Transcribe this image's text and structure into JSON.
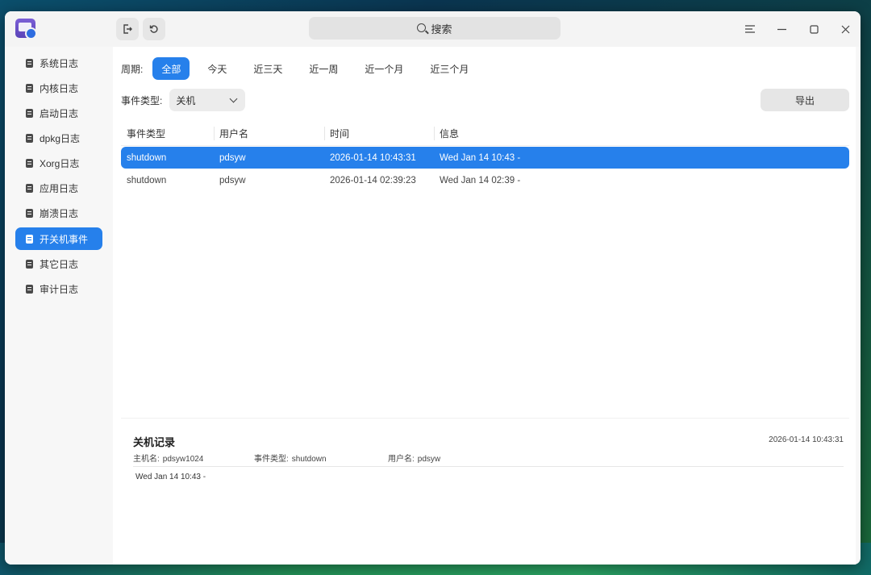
{
  "window": {
    "search_placeholder": "搜索",
    "icons": {
      "toolbar_1": "export-icon",
      "toolbar_2": "refresh-icon",
      "menu": "menu-icon",
      "minimize": "minimize-icon",
      "maximize": "maximize-icon",
      "close": "close-icon"
    }
  },
  "sidebar": {
    "items": [
      {
        "label": "系统日志"
      },
      {
        "label": "内核日志"
      },
      {
        "label": "启动日志"
      },
      {
        "label": "dpkg日志"
      },
      {
        "label": "Xorg日志"
      },
      {
        "label": "应用日志"
      },
      {
        "label": "崩溃日志"
      },
      {
        "label": "开关机事件",
        "active": true
      },
      {
        "label": "其它日志"
      },
      {
        "label": "审计日志"
      }
    ]
  },
  "filters": {
    "period_label": "周期:",
    "periods": [
      "全部",
      "今天",
      "近三天",
      "近一周",
      "近一个月",
      "近三个月"
    ],
    "active_period": "全部",
    "event_type_label": "事件类型:",
    "event_type_value": "关机",
    "export_label": "导出"
  },
  "table": {
    "columns": [
      "事件类型",
      "用户名",
      "时间",
      "信息"
    ],
    "rows": [
      {
        "type": "shutdown",
        "user": "pdsyw",
        "time": "2026-01-14 10:43:31",
        "info": "Wed Jan 14 10:43  -",
        "selected": true
      },
      {
        "type": "shutdown",
        "user": "pdsyw",
        "time": "2026-01-14 02:39:23",
        "info": "Wed Jan 14 02:39  -"
      }
    ]
  },
  "detail": {
    "title": "关机记录",
    "timestamp": "2026-01-14 10:43:31",
    "host_label": "主机名:",
    "host_value": "pdsyw1024",
    "type_label": "事件类型:",
    "type_value": "shutdown",
    "user_label": "用户名:",
    "user_value": "pdsyw",
    "info": "Wed Jan 14 10:43  -"
  },
  "colors": {
    "accent": "#2680eb"
  }
}
